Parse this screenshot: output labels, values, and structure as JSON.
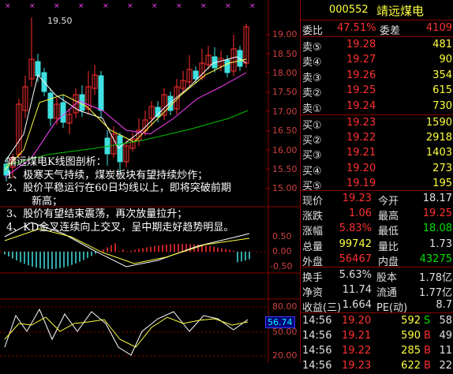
{
  "chart": {
    "price_ticks": [
      "19.00",
      "18.50",
      "18.00",
      "17.50",
      "17.00",
      "16.50",
      "16.00",
      "15.50",
      "15.00"
    ],
    "macd_ticks": [
      "0.50",
      "0.00",
      "-0.50"
    ],
    "kdj_ticks": [
      "80.00",
      "50.00",
      "20.00"
    ],
    "high_marker": "19.50",
    "kdj_value": "56.74",
    "annotation": {
      "title": "靖远煤电K线图剖析：",
      "lines": [
        "1、极寒天气持续，煤炭板块有望持续炒作；",
        "2、股价平稳运行在60日均线以上，即将突破前期",
        "新高；",
        "3、股价有望结束震荡，再次放量拉升；",
        "4、KD金叉连续向上交叉，呈中期走好趋势明显。"
      ]
    },
    "colors": {
      "up": "#ff3030",
      "down": "#40e0e0",
      "ma5": "#ffffff",
      "ma10": "#ffff40",
      "ma20": "#ff40ff",
      "ma60": "#00c000",
      "grid": "#8b0000"
    }
  },
  "panel": {
    "code": "000552",
    "name": "靖远煤电",
    "weibi_label": "委比",
    "weibi": "47.51%",
    "weicha_label": "委差",
    "weicha": "4109",
    "sells": [
      {
        "label": "卖⑤",
        "price": "19.28",
        "vol": "481"
      },
      {
        "label": "卖④",
        "price": "19.27",
        "vol": "90"
      },
      {
        "label": "卖③",
        "price": "19.26",
        "vol": "354"
      },
      {
        "label": "卖②",
        "price": "19.25",
        "vol": "615"
      },
      {
        "label": "卖①",
        "price": "19.24",
        "vol": "730"
      }
    ],
    "buys": [
      {
        "label": "买①",
        "price": "19.23",
        "vol": "1590"
      },
      {
        "label": "买②",
        "price": "19.22",
        "vol": "2918"
      },
      {
        "label": "买③",
        "price": "19.21",
        "vol": "1403"
      },
      {
        "label": "买④",
        "price": "19.20",
        "vol": "273"
      },
      {
        "label": "买⑤",
        "price": "19.19",
        "vol": "195"
      }
    ],
    "stats": [
      {
        "l1": "现价",
        "v1": "19.23",
        "c1": "red",
        "l2": "今开",
        "v2": "18.17",
        "c2": "white"
      },
      {
        "l1": "涨跌",
        "v1": "1.06",
        "c1": "red",
        "l2": "最高",
        "v2": "19.25",
        "c2": "red"
      },
      {
        "l1": "涨幅",
        "v1": "5.83%",
        "c1": "red",
        "l2": "最低",
        "v2": "18.08",
        "c2": "green"
      },
      {
        "l1": "总量",
        "v1": "99742",
        "c1": "yellow",
        "l2": "量比",
        "v2": "1.73",
        "c2": "white"
      },
      {
        "l1": "外盘",
        "v1": "56467",
        "c1": "red",
        "l2": "内盘",
        "v2": "43275",
        "c2": "green"
      }
    ],
    "stats2": [
      {
        "l1": "换手",
        "v1": "5.63%",
        "l2": "股本",
        "v2": "1.78亿"
      },
      {
        "l1": "净资",
        "v1": "11.74",
        "l2": "流通",
        "v2": "1.77亿"
      },
      {
        "l1": "收益(三)",
        "v1": "1.664",
        "l2": "PE(动)",
        "v2": "8.7"
      }
    ],
    "ticks": [
      {
        "time": "14:56",
        "price": "19.20",
        "vol": "592",
        "side": "S",
        "num": "58",
        "scolor": "green"
      },
      {
        "time": "14:56",
        "price": "19.21",
        "vol": "590",
        "side": "B",
        "num": "49",
        "scolor": "red"
      },
      {
        "time": "14:56",
        "price": "19.22",
        "vol": "285",
        "side": "B",
        "num": "11",
        "scolor": "red"
      },
      {
        "time": "14:56",
        "price": "19.23",
        "vol": "622",
        "side": "B",
        "num": "22",
        "scolor": "red"
      }
    ]
  }
}
